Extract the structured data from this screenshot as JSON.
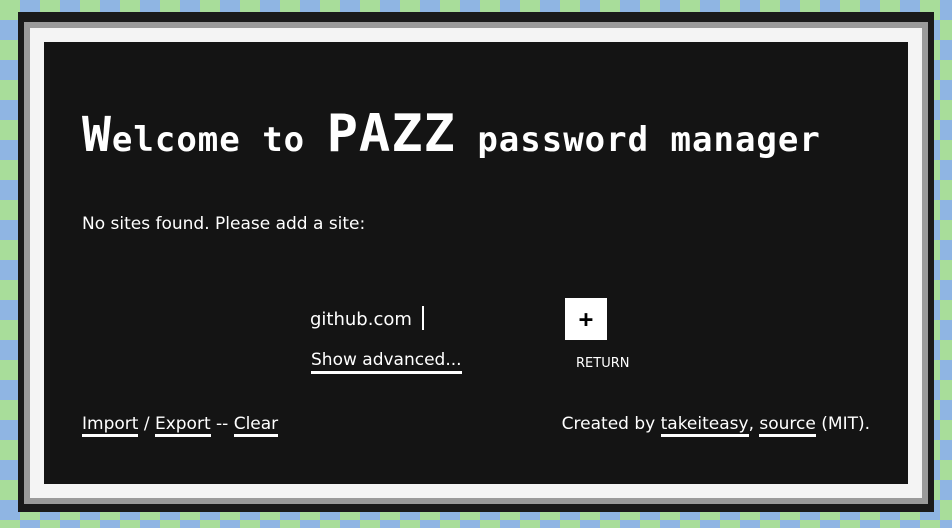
{
  "header": {
    "title_first_letter": "W",
    "title_part1": "elcome to ",
    "title_brand": "PAZZ",
    "title_part2": " password manager"
  },
  "status": {
    "message": "No sites found. Please add a site:"
  },
  "form": {
    "site_value": "github.com",
    "add_button_label": "+",
    "return_hint": "RETURN",
    "show_advanced_label": "Show advanced..."
  },
  "footer": {
    "import_label": "Import",
    "sep1": " / ",
    "export_label": "Export",
    "sep2": " -- ",
    "clear_label": "Clear",
    "created_by_prefix": "Created by ",
    "author_label": "takeiteasy",
    "comma": ", ",
    "source_label": "source",
    "license_suffix": " (MIT)."
  },
  "colors": {
    "panel_bg": "#141414",
    "text": "#ffffff",
    "checker_green": "#a8dd9a",
    "checker_blue": "#8fb5e3"
  }
}
